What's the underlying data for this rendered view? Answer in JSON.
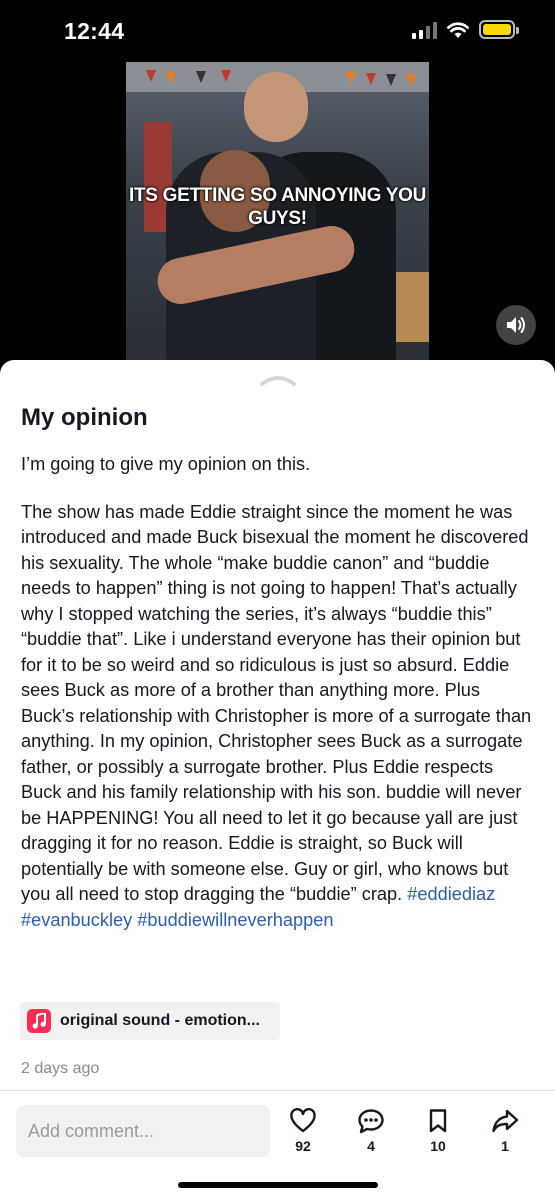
{
  "status_bar": {
    "time": "12:44",
    "battery_level": 1.0,
    "battery_color": "#f5d90a"
  },
  "video": {
    "caption": "ITS GETTING SO ANNOYING YOU GUYS!",
    "volume_icon": "speaker-volume-icon"
  },
  "post": {
    "title": "My opinion",
    "intro": "I’m going to give my opinion on this.",
    "body": "The show has made Eddie straight since the moment he was introduced and made Buck bisexual the moment he discovered his sexuality. The whole “make buddie canon” and “buddie needs to happen” thing is not going to happen! That’s actually why I stopped watching the series, it’s always “buddie this” “buddie that”. Like i understand everyone has their opinion but for it to be so weird and so ridiculous is just so absurd. Eddie sees Buck as more of a brother than anything more. Plus Buck’s relationship with Christopher is more of a surrogate than anything. In my opinion, Christopher sees Buck as a surrogate father, or possibly a surrogate brother. Plus Eddie respects Buck and his family relationship with his son. buddie will never be HAPPENING! You all need to let it go because yall are just dragging it for no reason. Eddie is straight, so Buck will potentially be with someone else. Guy or girl, who knows but you all need to stop dragging the “buddie” crap.",
    "hashtags": [
      "#eddiediaz",
      "#evanbuckley",
      "#buddiewillneverhappen"
    ],
    "hashtag_color": "#2b5db0",
    "sound_label": "original sound - emotion...",
    "sound_icon": "music-note-icon",
    "timestamp": "2 days ago"
  },
  "actions": {
    "comment_placeholder": "Add comment...",
    "likes": "92",
    "comments": "4",
    "saves": "10",
    "shares": "1"
  }
}
